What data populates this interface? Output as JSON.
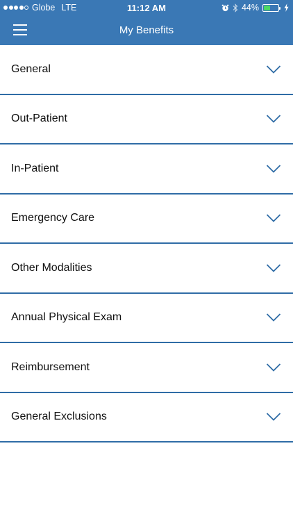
{
  "status_bar": {
    "carrier": "Globe",
    "network": "LTE",
    "time": "11:12 AM",
    "battery_percent": "44%",
    "battery_level": 0.44,
    "signal_bars": 4,
    "signal_total": 5,
    "icons": [
      "alarm-icon",
      "bluetooth-icon",
      "battery-icon",
      "charging-bolt-icon"
    ]
  },
  "nav": {
    "title": "My Benefits",
    "menu_icon": "hamburger-menu-icon"
  },
  "benefits": {
    "items": [
      {
        "label": "General"
      },
      {
        "label": "Out-Patient"
      },
      {
        "label": "In-Patient"
      },
      {
        "label": "Emergency Care"
      },
      {
        "label": "Other Modalities"
      },
      {
        "label": "Annual Physical Exam"
      },
      {
        "label": "Reimbursement"
      },
      {
        "label": "General Exclusions"
      }
    ],
    "expand_icon": "chevron-down-icon"
  },
  "colors": {
    "header": "#3a78b5",
    "divider": "#2f6ca6",
    "chevron": "#2f6ca6",
    "battery_fill": "#4cd964"
  }
}
